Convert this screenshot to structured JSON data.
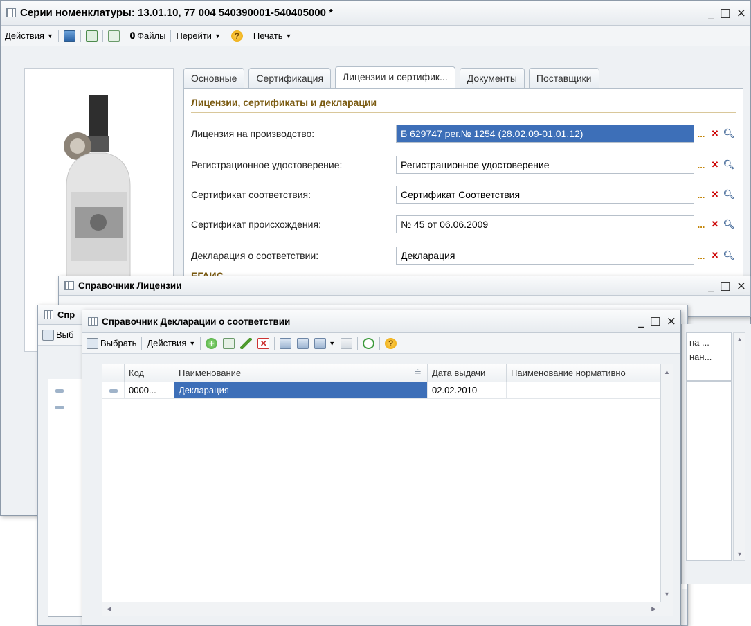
{
  "main_window": {
    "title": "Серии номенклатуры: 13.01.10, 77 004 540390001-540405000 *",
    "toolbar": {
      "actions_label": "Действия",
      "files_label": "Файлы",
      "goto_label": "Перейти",
      "print_label": "Печать"
    },
    "tabs": [
      "Основные",
      "Сертификация",
      "Лицензии и сертифик...",
      "Документы",
      "Поставщики"
    ],
    "active_tab": "Лицензии и сертифик...",
    "section_title": "Лицензии, сертификаты и декларации",
    "section_cutoff": "ЕГАИС",
    "fields": [
      {
        "label": "Лицензия на производство:",
        "value": "Б 629747 рег.№ 1254 (28.02.09-01.01.12)"
      },
      {
        "label": "Регистрационное удостоверение:",
        "value": "Регистрационное удостоверение"
      },
      {
        "label": "Сертификат соответствия:",
        "value": "Сертификат Соответствия"
      },
      {
        "label": "Сертификат происхождения:",
        "value": "№ 45 от 06.06.2009"
      },
      {
        "label": "Декларация о соответствии:",
        "value": "Декларация"
      }
    ]
  },
  "licenses_window": {
    "title": "Справочник Лицензии"
  },
  "back_window": {
    "title_fragment": "Спр",
    "select_fragment": "Выб",
    "right_header_1": "на ...",
    "right_header_2": "нан..."
  },
  "declarations_window": {
    "title": "Справочник Декларации о соответствии",
    "toolbar": {
      "select_label": "Выбрать",
      "actions_label": "Действия"
    },
    "columns": [
      "Код",
      "Наименование",
      "Дата выдачи",
      "Наименование нормативно"
    ],
    "rows": [
      {
        "code": "0000...",
        "name": "Декларация",
        "date": "02.02.2010",
        "norm": ""
      }
    ]
  },
  "colors": {
    "selection": "#3d6fb8",
    "section_title": "#7a5a10",
    "window_bg": "#eef1f4"
  }
}
